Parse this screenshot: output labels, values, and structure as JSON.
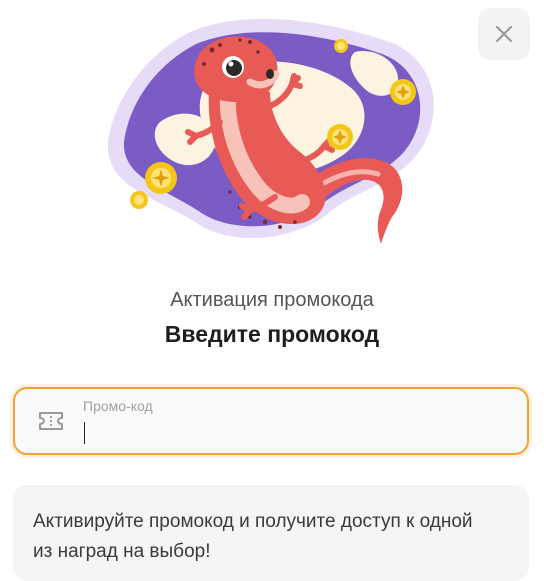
{
  "dialog": {
    "subtitle": "Активация промокода",
    "title": "Введите промокод"
  },
  "promo_input": {
    "label": "Промо-код",
    "value": "",
    "placeholder": ""
  },
  "info": {
    "text": "Активируйте промокод и получите доступ к одной из наград на выбор!"
  },
  "icons": {
    "close": "close-icon",
    "ticket": "ticket-icon",
    "illustration": "salamander-illustration"
  },
  "colors": {
    "accent": "#f4a234",
    "salamander": "#e85a56",
    "blob": "#7b5cc4",
    "coin": "#f5c518"
  }
}
